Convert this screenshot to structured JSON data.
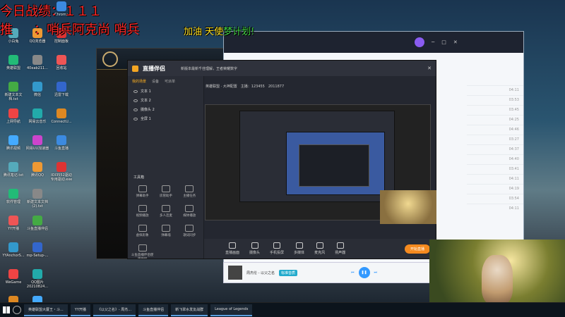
{
  "overlay": {
    "line1": "今日战绩：１１１",
    "line2_a": "推",
    "line2_b": "：哨兵阿克尚 哨兵",
    "line2_c": "加油 天使",
    "line2_d": "梦计划!"
  },
  "desktop_icons": [
    {
      "label": "Chrome"
    },
    {
      "label": "小白兔"
    },
    {
      "label": "QQ浏览器"
    },
    {
      "label": "控制面板"
    },
    {
      "label": "英雄联盟"
    },
    {
      "label": "40eab211..."
    },
    {
      "label": "回收站"
    },
    {
      "label": "新建文本文档.txt"
    },
    {
      "label": "微信"
    },
    {
      "label": "迅雷下载"
    },
    {
      "label": "上网导航"
    },
    {
      "label": "网易云音乐"
    },
    {
      "label": "ConnectU..."
    },
    {
      "label": "腾讯视频"
    },
    {
      "label": "网易UU加速器"
    },
    {
      "label": "斗鱼直播"
    },
    {
      "label": "腾讯笔记.txt"
    },
    {
      "label": "腾讯QQ"
    },
    {
      "label": "IOI3552驱动专用驱动.exe"
    },
    {
      "label": "软件管理"
    },
    {
      "label": "新建文本文档(2).txt"
    },
    {
      "label": "YY开播"
    },
    {
      "label": "斗鱼直播伴侣"
    },
    {
      "label": "YYAnchorS..."
    },
    {
      "label": "mp-Setup-..."
    },
    {
      "label": "WeGame"
    },
    {
      "label": "QQ图片20210824..."
    },
    {
      "label": "Steam"
    },
    {
      "label": "腾讯手游助手"
    }
  ],
  "zb": {
    "title": "直播伴侣",
    "notice": "新版本最新千佳理解，王者荣耀数字",
    "tabs": [
      "我的场景",
      "设备",
      "可派单"
    ],
    "sources": [
      "文本 1",
      "文本 2",
      "摄像头 2",
      "全屏 1"
    ],
    "tools_title": "工具箱",
    "tools": [
      "弹幕助手",
      "房管助手",
      "主播任务",
      "视频播放",
      "多人连麦",
      "媒体播放",
      "虚拟形象",
      "弹幕墙",
      "歌词同步",
      "斗鱼直播伴侣使用教程"
    ],
    "bottom": [
      "直播画面",
      "摄像头",
      "手机投屏",
      "多媒体",
      "麦克风",
      "扬声器"
    ],
    "start": "开始直播",
    "meta": "英雄联盟 · 大神配置　主播：123455　2011877"
  },
  "kugou": {
    "times": [
      "04:11",
      "03:53",
      "03:45",
      "04:25",
      "04:46",
      "03:27",
      "04:37",
      "04:40",
      "03:41",
      "04:11",
      "04:19",
      "03:54",
      "04:11"
    ],
    "song": "周杰伦 - 以父之名",
    "quality": "标准音质"
  },
  "taskbar": {
    "items": [
      "英雄联盟大厦王・斗...",
      "YY开播",
      "《以父之名》- 周杰...",
      "斗鱼直播伴侣",
      "新飞翠水发友战群",
      "League of Legends"
    ]
  }
}
